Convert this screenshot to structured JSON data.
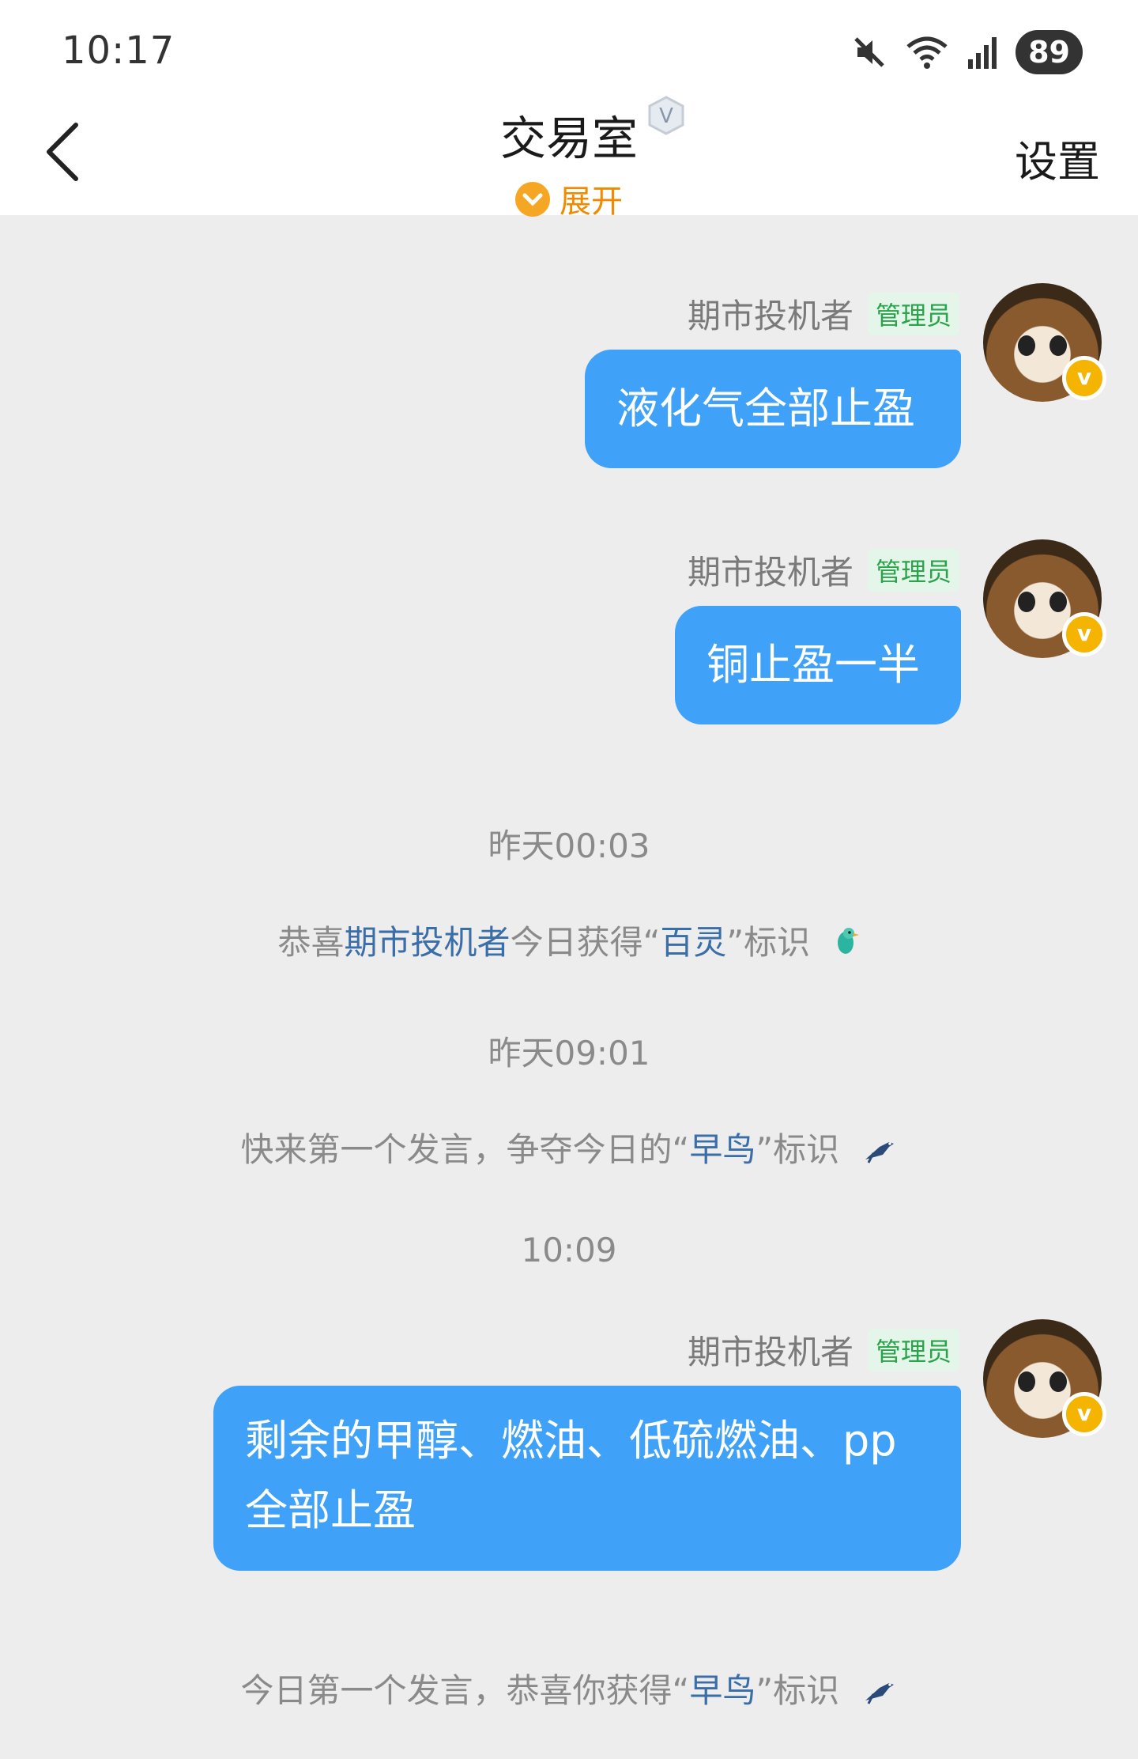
{
  "status": {
    "time": "10:17",
    "battery": "89"
  },
  "header": {
    "title": "交易室",
    "expand_label": "展开",
    "settings_label": "设置"
  },
  "messages": [
    {
      "sender": "期市投机者",
      "badge": "管理员",
      "text": "液化气全部止盈"
    },
    {
      "sender": "期市投机者",
      "badge": "管理员",
      "text": "铜止盈一半"
    },
    {
      "sender": "期市投机者",
      "badge": "管理员",
      "text_line1": "剩余的甲醇、燃油、低硫燃油、pp",
      "text_line2": "全部止盈"
    }
  ],
  "timestamps": [
    "昨天00:03",
    "昨天09:01",
    "10:09"
  ],
  "system": [
    {
      "prefix": "恭喜",
      "name": "期市投机者",
      "mid": "今日获得“",
      "tag": "百灵",
      "suffix": "”标识"
    },
    {
      "prefix": "快来第一个发言，争夺今日的“",
      "tag": "早鸟",
      "suffix": "”标识"
    },
    {
      "prefix": "今日第一个发言，恭喜你获得“",
      "tag": "早鸟",
      "suffix": "”标识"
    }
  ],
  "colors": {
    "bubble": "#3fa1f7",
    "admin_badge": "#2aa34a",
    "highlight": "#3a6ea8",
    "expand": "#f08a00"
  },
  "icons": [
    "back-icon",
    "verified-icon",
    "mute-icon",
    "wifi-icon",
    "signal-icon",
    "chevron-down-icon",
    "bird-icon"
  ]
}
